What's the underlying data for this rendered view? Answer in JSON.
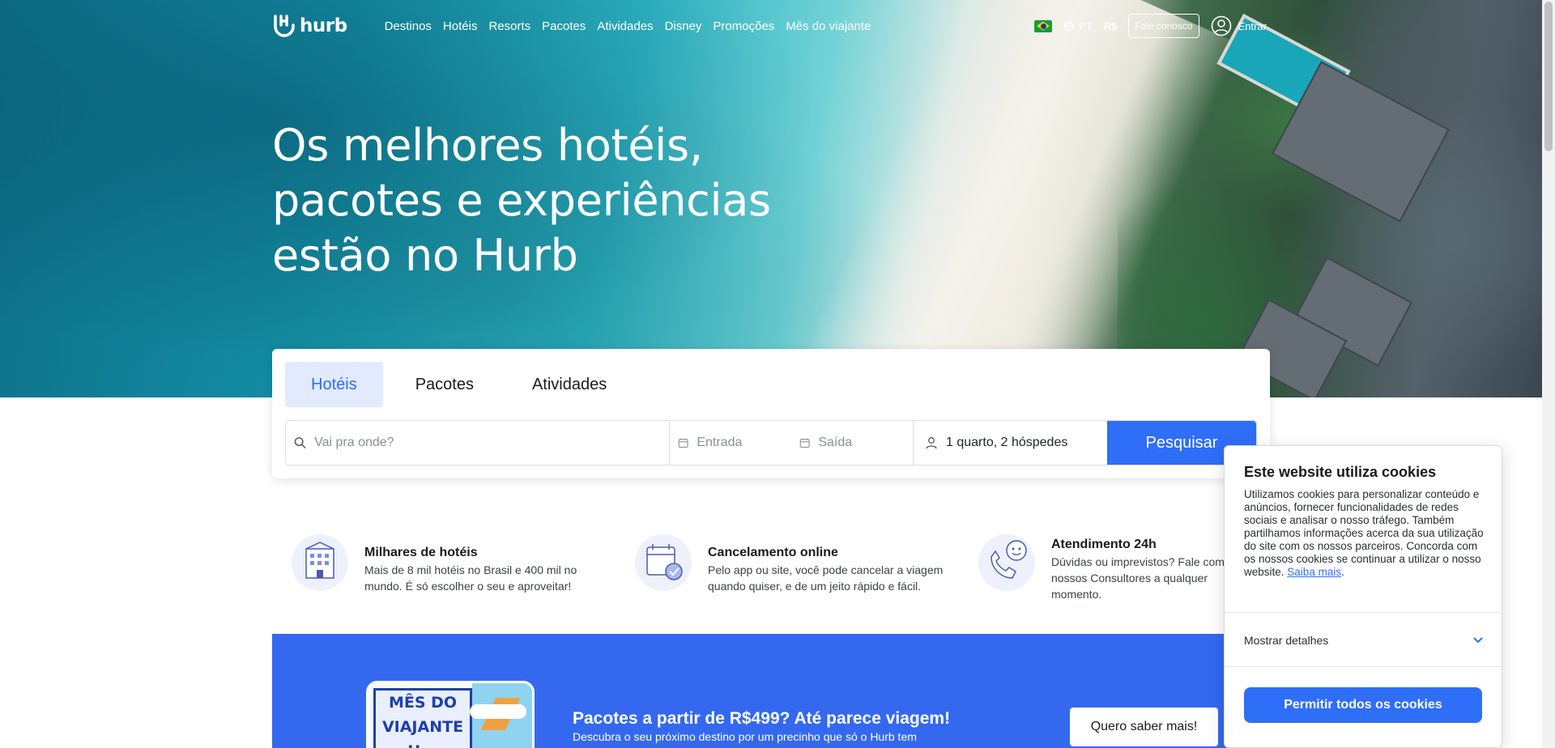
{
  "brand": {
    "logo_text": "hurb",
    "accent": "#2f6ef6"
  },
  "nav": {
    "links": [
      "Destinos",
      "Hotéis",
      "Resorts",
      "Pacotes",
      "Atividades",
      "Disney",
      "Promoções",
      "Mês do viajante"
    ],
    "language": "PT",
    "currency": "R$",
    "contact_button": "Fale conosco",
    "login_label": "Entrar"
  },
  "hero": {
    "headline_lines": [
      "Os melhores hotéis,",
      "pacotes e experiências",
      "estão no Hurb"
    ]
  },
  "search": {
    "tabs": [
      "Hotéis",
      "Pacotes",
      "Atividades"
    ],
    "active_tab": "Hotéis",
    "destination_placeholder": "Vai pra onde?",
    "checkin_placeholder": "Entrada",
    "checkout_placeholder": "Saída",
    "guests_value": "1 quarto, 2 hóspedes",
    "submit_label": "Pesquisar"
  },
  "features": [
    {
      "title": "Milhares de hotéis",
      "text": "Mais de 8 mil hotéis no Brasil e 400 mil no mundo. É só escolher o seu e aproveitar!",
      "icon": "hotel-building-icon"
    },
    {
      "title": "Cancelamento online",
      "text": "Pelo app ou site, você pode cancelar a viagem quando quiser, e de um jeito rápido e fácil.",
      "icon": "calendar-check-icon"
    },
    {
      "title": "Atendimento 24h",
      "text": "Dúvidas ou imprevistos? Fale com nossos Consultores a qualquer momento.",
      "icon": "phone-chat-icon"
    }
  ],
  "promo": {
    "art_text": [
      "MÊS DO",
      "VIAJANTE",
      "H..."
    ],
    "title": "Pacotes a partir de R$499? Até parece viagem!",
    "subtitle": "Descubra o seu próximo destino por um precinho que só o Hurb tem",
    "button": "Quero saber mais!"
  },
  "cookie_banner": {
    "title": "Este website utiliza cookies",
    "body": "Utilizamos cookies para personalizar conteúdo e anúncios, fornecer funcionalidades de redes sociais e analisar o nosso tráfego. Também partilhamos informações acerca da sua utilização do site com os nossos parceiros. Concorda com os nossos cookies se continuar a utilizar o nosso website.",
    "learn_more": "Saiba mais",
    "details_label": "Mostrar detalhes",
    "allow_button": "Permitir todos os cookies"
  }
}
